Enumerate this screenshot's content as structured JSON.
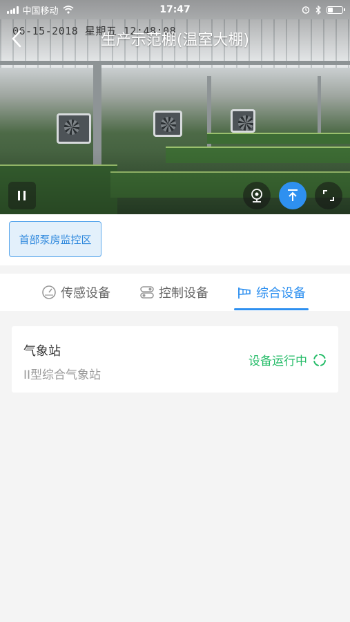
{
  "status_bar": {
    "carrier": "中国移动",
    "time": "17:47",
    "battery_level": 0.35
  },
  "video": {
    "timestamp": "06-15-2018 星期五 12:48:08",
    "title": "生产示范棚(温室大棚)",
    "controls": [
      "pause-icon",
      "camera-icon",
      "to-top-icon",
      "fullscreen-icon"
    ]
  },
  "zone": {
    "selected": "首部泵房监控区"
  },
  "tabs": [
    {
      "label": "传感设备",
      "icon": "gauge-icon",
      "active": false
    },
    {
      "label": "控制设备",
      "icon": "switch-icon",
      "active": false
    },
    {
      "label": "综合设备",
      "icon": "windsock-icon",
      "active": true
    }
  ],
  "devices": [
    {
      "name": "气象站",
      "type": "II型综合气象站",
      "status": "设备运行中"
    }
  ],
  "colors": {
    "accent": "#2e90f0",
    "status_ok": "#22bb66"
  }
}
